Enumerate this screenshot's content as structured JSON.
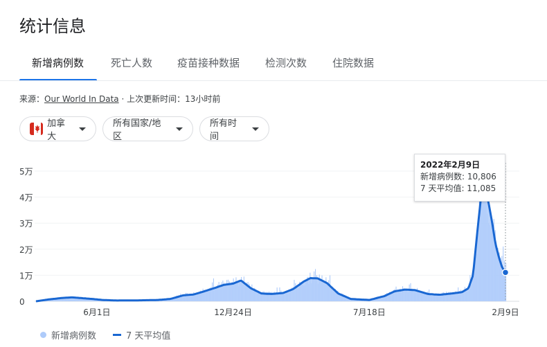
{
  "header": {
    "title": "统计信息"
  },
  "tabs": [
    {
      "label": "新增病例数",
      "active": true
    },
    {
      "label": "死亡人数"
    },
    {
      "label": "疫苗接种数据"
    },
    {
      "label": "检测次数"
    },
    {
      "label": "住院数据"
    }
  ],
  "source": {
    "prefix": "来源：",
    "link": "Our World In Data",
    "suffix": " · 上次更新时间：13小时前"
  },
  "filters": {
    "country": "加拿大",
    "region": "所有国家/地区",
    "time": "所有时间"
  },
  "tooltip": {
    "date": "2022年2月9日",
    "line1": "新增病例数: 10,806",
    "line2": "7 天平均值: 11,085"
  },
  "legend": {
    "bars": "新增病例数",
    "avg": "7 天平均值"
  },
  "colors": {
    "accent": "#1a73e8",
    "avg_line": "#1967d2",
    "bars": "#aecbfa"
  },
  "chart_data": {
    "type": "bar",
    "y_ticks": [
      "0",
      "1万",
      "2万",
      "3万",
      "4万",
      "5万"
    ],
    "x_ticks": [
      "6月1日",
      "12月24日",
      "7月18日",
      "2月9日"
    ],
    "ylim": [
      0,
      50000
    ],
    "grid": true,
    "series": [
      {
        "name": "7 天平均值",
        "kind": "line",
        "x": [
          "2020-03-01",
          "2020-03-20",
          "2020-04-10",
          "2020-04-25",
          "2020-05-10",
          "2020-05-25",
          "2020-06-10",
          "2020-07-01",
          "2020-08-01",
          "2020-09-01",
          "2020-09-20",
          "2020-10-10",
          "2020-10-25",
          "2020-11-10",
          "2020-11-25",
          "2020-12-10",
          "2020-12-24",
          "2021-01-05",
          "2021-01-20",
          "2021-02-05",
          "2021-02-20",
          "2021-03-10",
          "2021-03-25",
          "2021-04-10",
          "2021-04-20",
          "2021-05-01",
          "2021-05-15",
          "2021-06-01",
          "2021-06-20",
          "2021-07-18",
          "2021-08-10",
          "2021-08-25",
          "2021-09-10",
          "2021-09-25",
          "2021-10-15",
          "2021-11-01",
          "2021-11-20",
          "2021-12-05",
          "2021-12-15",
          "2021-12-22",
          "2021-12-29",
          "2022-01-03",
          "2022-01-07",
          "2022-01-11",
          "2022-01-15",
          "2022-01-20",
          "2022-01-25",
          "2022-01-30",
          "2022-02-04",
          "2022-02-09"
        ],
        "values": [
          0,
          700,
          1300,
          1500,
          1200,
          900,
          500,
          300,
          350,
          500,
          900,
          2300,
          2600,
          3800,
          5000,
          6300,
          6800,
          8000,
          5000,
          3000,
          2800,
          3200,
          4700,
          7600,
          8900,
          8800,
          7000,
          3000,
          900,
          500,
          2000,
          3800,
          4500,
          4300,
          2800,
          2500,
          3000,
          3500,
          5000,
          10000,
          28000,
          40000,
          44000,
          42000,
          37000,
          30000,
          22000,
          17000,
          13000,
          11085
        ]
      },
      {
        "name": "新增病例数",
        "kind": "bar",
        "note": "daily values fluctuate around the 7 天平均值 line",
        "last_value": 10806
      }
    ]
  }
}
